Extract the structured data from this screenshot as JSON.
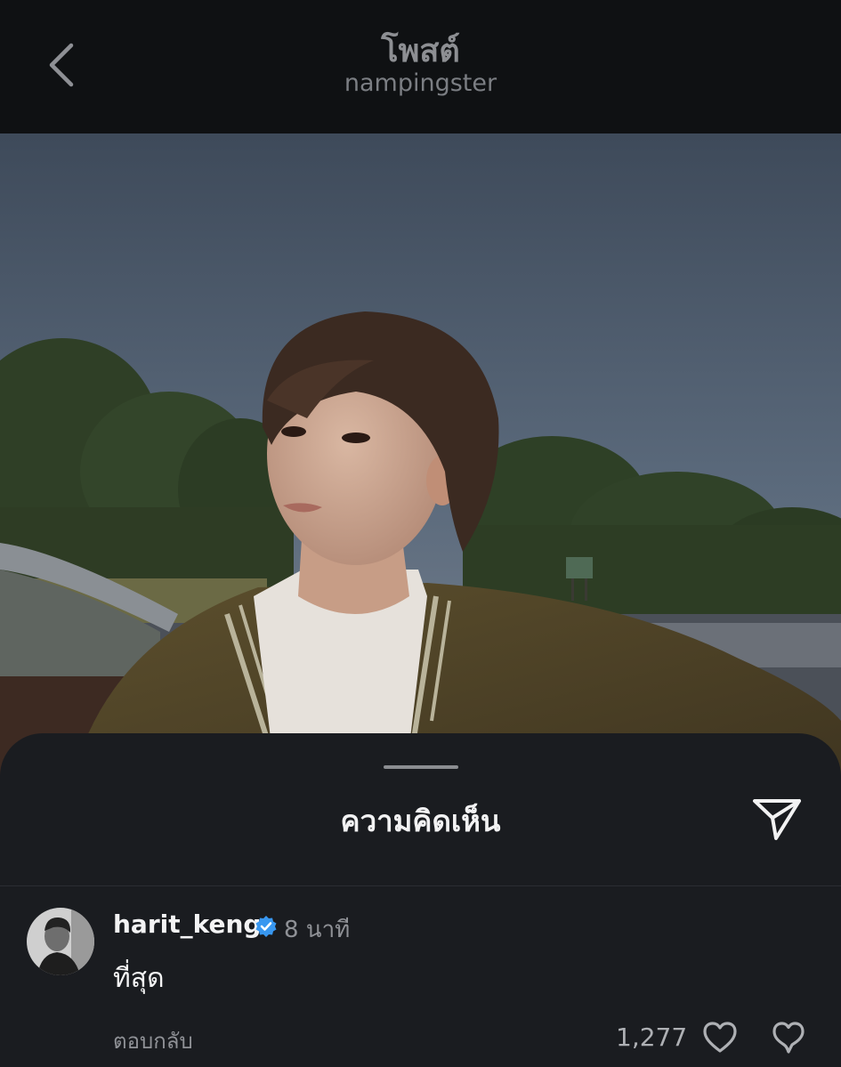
{
  "header": {
    "title": "โพสต์",
    "subtitle": "nampingster",
    "back_icon": "chevron-left-icon"
  },
  "post": {
    "image_description_icon": "photo"
  },
  "comments_sheet": {
    "title": "ความคิดเห็น",
    "share_icon": "send-icon"
  },
  "comment": {
    "username": "harit_keng",
    "verified": true,
    "time": "8 นาที",
    "text": "ที่สุด",
    "reply_label": "ตอบกลับ",
    "like_count": "1,277",
    "like_icon": "heart-icon",
    "dislike_icon": "dislike-icon"
  },
  "colors": {
    "background": "#0f1113",
    "sheet": "#1a1c20",
    "verified_blue": "#3897f0"
  }
}
